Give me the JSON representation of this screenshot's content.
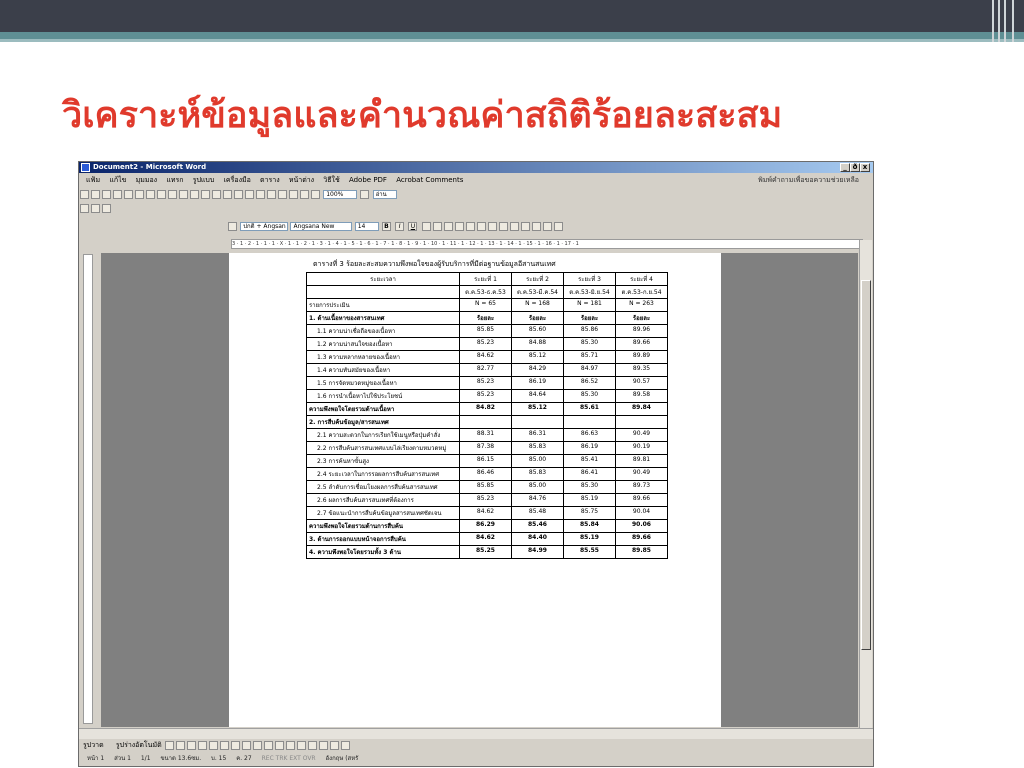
{
  "slide": {
    "title": "วิเคราะห์ข้อมูลและคำนวณค่าสถิติร้อยละสะสม"
  },
  "window": {
    "title": "Document2 - Microsoft Word",
    "minimize": "_",
    "maximize": "ð",
    "close": "x"
  },
  "menubar": {
    "items": [
      "แฟ้ม",
      "แก้ไข",
      "มุมมอง",
      "แทรก",
      "รูปแบบ",
      "เครื่องมือ",
      "ตาราง",
      "หน้าต่าง",
      "วิธีใช้",
      "Adobe PDF",
      "Acrobat Comments"
    ],
    "help_box": "พิมพ์คำถามเพื่อขอความช่วยเหลือ"
  },
  "toolbar": {
    "zoom": "100%",
    "read": "อ่าน",
    "style": "ปกติ + Angsan",
    "font": "Angsana New",
    "size": "14",
    "bold": "B",
    "italic": "I",
    "underline": "U"
  },
  "ruler": {
    "text": "3 · 1 · 2 · 1 · 1 · 1 · X · 1 · 1 · 2 · 1 · 3 · 1 · 4 · 1 · 5 · 1 · 6 · 1 · 7 · 1 · 8 · 1 · 9 · 1 · 10 · 1 · 11 · 1 · 12 · 1 · 13 · 1 · 14 · 1 · 15 · 1 · 16 · 1 · 17 · 1"
  },
  "table": {
    "caption": "ตารางที่ 3  ร้อยละสะสมความพึงพอใจของผู้รับบริการที่มีต่อฐานข้อมูลอีสานสนเทศ",
    "period_label": "ระยะเวลา",
    "item_label": "รายการประเมิน",
    "periods": [
      "ระยะที่ 1",
      "ระยะที่ 2",
      "ระยะที่ 3",
      "ระยะที่ 4"
    ],
    "date_ranges": [
      "ต.ค.53-ธ.ค.53",
      "ต.ค.53-มี.ค.54",
      "ต.ค.53-มิ.ย.54",
      "ต.ค.53-ก.ย.54"
    ],
    "n_values": [
      "N = 65",
      "N = 168",
      "N = 181",
      "N = 263"
    ],
    "unit": "ร้อยละ",
    "rows": [
      {
        "label": "1. ด้านเนื้อหาของสารสนเทศ",
        "values": [
          "ร้อยละ",
          "ร้อยละ",
          "ร้อยละ",
          "ร้อยละ"
        ],
        "kind": "head"
      },
      {
        "label": "1.1 ความน่าเชื่อถือของเนื้อหา",
        "values": [
          "85.85",
          "85.60",
          "85.86",
          "89.96"
        ],
        "kind": "item"
      },
      {
        "label": "1.2 ความน่าสนใจของเนื้อหา",
        "values": [
          "85.23",
          "84.88",
          "85.30",
          "89.66"
        ],
        "kind": "item"
      },
      {
        "label": "1.3 ความหลากหลายของเนื้อหา",
        "values": [
          "84.62",
          "85.12",
          "85.71",
          "89.89"
        ],
        "kind": "item"
      },
      {
        "label": "1.4 ความทันสมัยของเนื้อหา",
        "values": [
          "82.77",
          "84.29",
          "84.97",
          "89.35"
        ],
        "kind": "item"
      },
      {
        "label": "1.5 การจัดหมวดหมู่ของเนื้อหา",
        "values": [
          "85.23",
          "86.19",
          "86.52",
          "90.57"
        ],
        "kind": "item"
      },
      {
        "label": "1.6 การนำเนื้อหาไปใช้ประโยชน์",
        "values": [
          "85.23",
          "84.64",
          "85.30",
          "89.58"
        ],
        "kind": "item"
      },
      {
        "label": "ความพึงพอใจโดยรวมด้านเนื้อหา",
        "values": [
          "84.82",
          "85.12",
          "85.61",
          "89.84"
        ],
        "kind": "sum"
      },
      {
        "label": "2. การสืบค้นข้อมูล/สารสนเทศ",
        "values": [
          "",
          "",
          "",
          ""
        ],
        "kind": "head"
      },
      {
        "label": "2.1 ความสะดวกในการเรียกใช้เมนูหรือปุ่มคำสั่ง",
        "values": [
          "88.31",
          "86.31",
          "86.63",
          "90.49"
        ],
        "kind": "item"
      },
      {
        "label": "2.2 การสืบค้นสารสนเทศแบบไล่เรียงตามหมวดหมู่",
        "values": [
          "87.38",
          "85.83",
          "86.19",
          "90.19"
        ],
        "kind": "item"
      },
      {
        "label": "2.3 การค้นหาขั้นสูง",
        "values": [
          "86.15",
          "85.00",
          "85.41",
          "89.81"
        ],
        "kind": "item"
      },
      {
        "label": "2.4 ระยะเวลาในการรอผลการสืบค้นสารสนเทศ",
        "values": [
          "86.46",
          "85.83",
          "86.41",
          "90.49"
        ],
        "kind": "item"
      },
      {
        "label": "2.5 ลำดับการเชื่อมโยงผลการสืบค้นสารสนเทศ",
        "values": [
          "85.85",
          "85.00",
          "85.30",
          "89.73"
        ],
        "kind": "item"
      },
      {
        "label": "2.6 ผลการสืบค้นสารสนเทศที่ต้องการ",
        "values": [
          "85.23",
          "84.76",
          "85.19",
          "89.66"
        ],
        "kind": "item"
      },
      {
        "label": "2.7 ข้อแนะนำการสืบค้นข้อมูลสารสนเทศชัดเจน",
        "values": [
          "84.62",
          "85.48",
          "85.75",
          "90.04"
        ],
        "kind": "item"
      },
      {
        "label": "ความพึงพอใจโดยรวมด้านการสืบค้น",
        "values": [
          "86.29",
          "85.46",
          "85.84",
          "90.06"
        ],
        "kind": "sum"
      },
      {
        "label": "3. ด้านการออกแบบหน้าจอการสืบค้น",
        "values": [
          "84.62",
          "84.40",
          "85.19",
          "89.66"
        ],
        "kind": "sum"
      },
      {
        "label": "4. ความพึงพอใจโดยรวมทั้ง 3 ด้าน",
        "values": [
          "85.25",
          "84.99",
          "85.55",
          "89.85"
        ],
        "kind": "sum"
      }
    ]
  },
  "drawbar": {
    "draw": "รูปวาด",
    "autoshapes": "รูปร่างอัตโนมัติ"
  },
  "status": {
    "page": "หน้า 1",
    "section": "ส่วน 1",
    "pages": "1/1",
    "position": "ขนาด 13.6ซม.",
    "line": "บ. 15",
    "column": "ค. 27",
    "modes": "REC  TRK  EXT  OVR",
    "language": "อังกฤษ (สหรั"
  }
}
